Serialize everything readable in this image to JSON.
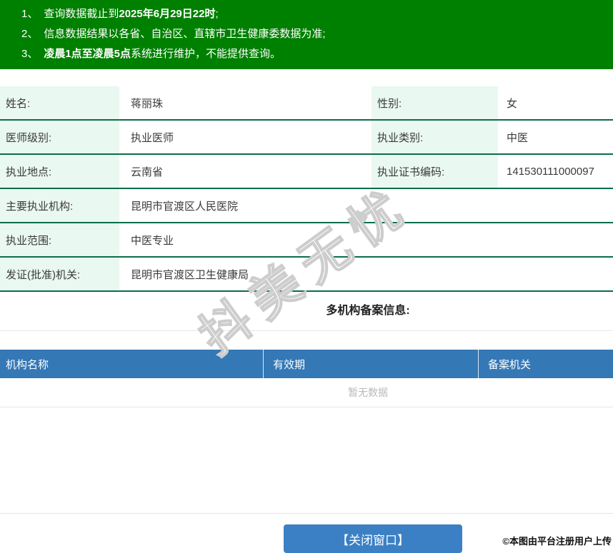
{
  "colors": {
    "green": "#008000",
    "row-border": "#0b6d4a",
    "label-bg": "#e9f8f0",
    "table-blue": "#3478b6",
    "button-blue": "#3b80c4",
    "muted": "#b9b9b9"
  },
  "notices": {
    "items": [
      {
        "num": "1、",
        "pre": "查询数据截止到",
        "bold": "2025年6月29日22时",
        "post": ";"
      },
      {
        "num": "2、",
        "pre": "信息数据结果以各省、自治区、直辖市卫生健康委数据为准;",
        "bold": "",
        "post": ""
      },
      {
        "num": "3、",
        "pre": "",
        "bold": "凌晨1点至凌晨5点",
        "post": "系统进行维护，不能提供查询。"
      }
    ]
  },
  "info": {
    "rows": [
      {
        "l1": "姓名:",
        "v1": "蒋丽珠",
        "l2": "性别:",
        "v2": "女"
      },
      {
        "l1": "医师级别:",
        "v1": "执业医师",
        "l2": "执业类别:",
        "v2": "中医"
      },
      {
        "l1": "执业地点:",
        "v1": "云南省",
        "l2": "执业证书编码:",
        "v2": "141530111000097"
      },
      {
        "l1": "主要执业机构:",
        "v1": "昆明市官渡区人民医院"
      },
      {
        "l1": "执业范围:",
        "v1": "中医专业"
      },
      {
        "l1": "发证(批准)机关:",
        "v1": "昆明市官渡区卫生健康局"
      }
    ]
  },
  "records": {
    "title": "多机构备案信息:",
    "headers": [
      "机构名称",
      "有效期",
      "备案机关"
    ],
    "empty_text": "暂无数据"
  },
  "footer": {
    "close_button": "【关闭窗口】",
    "credit": "©本图由平台注册用户上传"
  },
  "watermark": "抖美无忧"
}
